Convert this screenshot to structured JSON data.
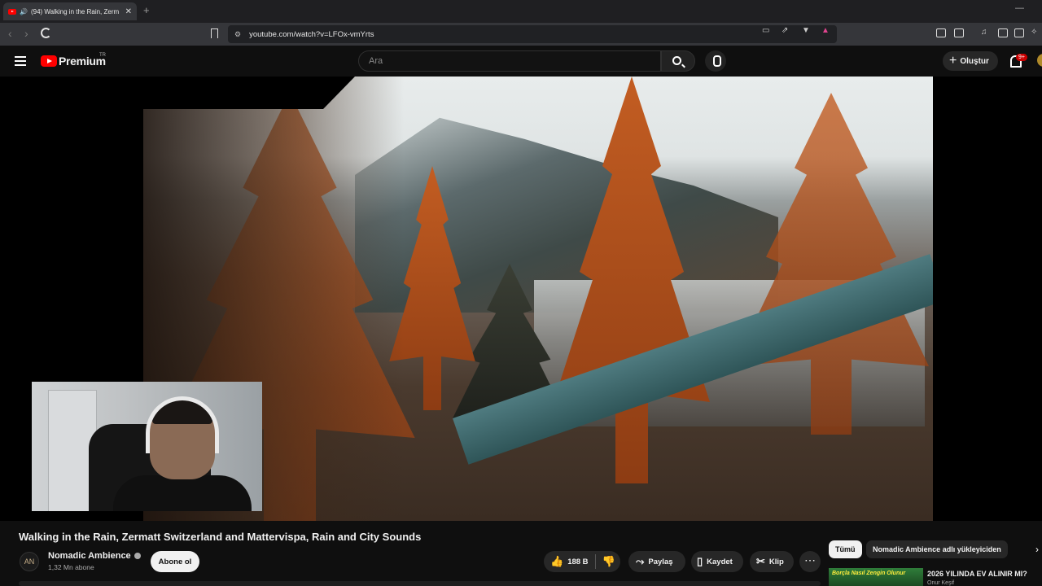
{
  "browser": {
    "tab_title": "(94) Walking in the Rain, Zerm",
    "tab_close": "✕",
    "new_tab": "+",
    "url": "youtube.com/watch?v=LFOx-vmYrts",
    "window_controls": "—"
  },
  "header": {
    "logo_text": "Premium",
    "region": "TR",
    "search_placeholder": "Ara",
    "create_label": "Oluştur",
    "notification_count": "9+"
  },
  "video": {
    "title": "Walking in the Rain, Zermatt Switzerland and Mattervispa, Rain and City Sounds"
  },
  "channel": {
    "name": "Nomadic Ambience",
    "subscribers": "1,32 Mn abone",
    "subscribe_label": "Abone ol",
    "avatar_text": "AN"
  },
  "actions": {
    "like_count": "188 B",
    "share_label": "Paylaş",
    "save_label": "Kaydet",
    "clip_label": "Klip",
    "more": "⋯"
  },
  "sidebar": {
    "chips": [
      "Tümü",
      "Nomadic Ambience adlı yükleyiciden"
    ],
    "rec_title": "2026 YILINDA EV ALINIR MI?",
    "rec_channel": "Onur Keşif",
    "rec_thumb_text": "Borçla Nasıl Zengin Olunur"
  },
  "icons": {
    "like": "like-icon",
    "dislike": "dislike-icon",
    "share": "share-icon",
    "save": "save-icon",
    "clip": "scissors-icon"
  },
  "colors": {
    "brand_red": "#ff0000",
    "background": "#0f0f0f",
    "pill": "#272727"
  }
}
